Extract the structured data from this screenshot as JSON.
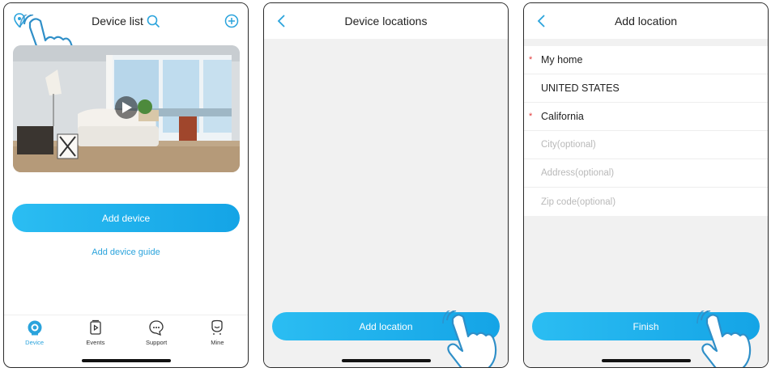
{
  "panel1": {
    "title": "Device list",
    "add_device": "Add device",
    "add_guide": "Add device guide",
    "tabs": [
      {
        "label": "Device",
        "icon": "camera-icon",
        "active": true
      },
      {
        "label": "Events",
        "icon": "events-icon",
        "active": false
      },
      {
        "label": "Support",
        "icon": "support-icon",
        "active": false
      },
      {
        "label": "Mine",
        "icon": "mine-icon",
        "active": false
      }
    ]
  },
  "panel2": {
    "title": "Device locations",
    "add_location": "Add location"
  },
  "panel3": {
    "title": "Add location",
    "fields": [
      {
        "value": "My home",
        "required": true,
        "placeholder": false
      },
      {
        "value": "UNITED STATES",
        "required": false,
        "placeholder": false
      },
      {
        "value": "California",
        "required": true,
        "placeholder": false
      },
      {
        "value": "City(optional)",
        "required": false,
        "placeholder": true
      },
      {
        "value": "Address(optional)",
        "required": false,
        "placeholder": true
      },
      {
        "value": "Zip code(optional)",
        "required": false,
        "placeholder": true
      }
    ],
    "finish": "Finish"
  },
  "colors": {
    "accent": "#1aa9ea",
    "required": "#e23b3b",
    "placeholder": "#b9b9b9",
    "link": "#2aa3dc"
  }
}
